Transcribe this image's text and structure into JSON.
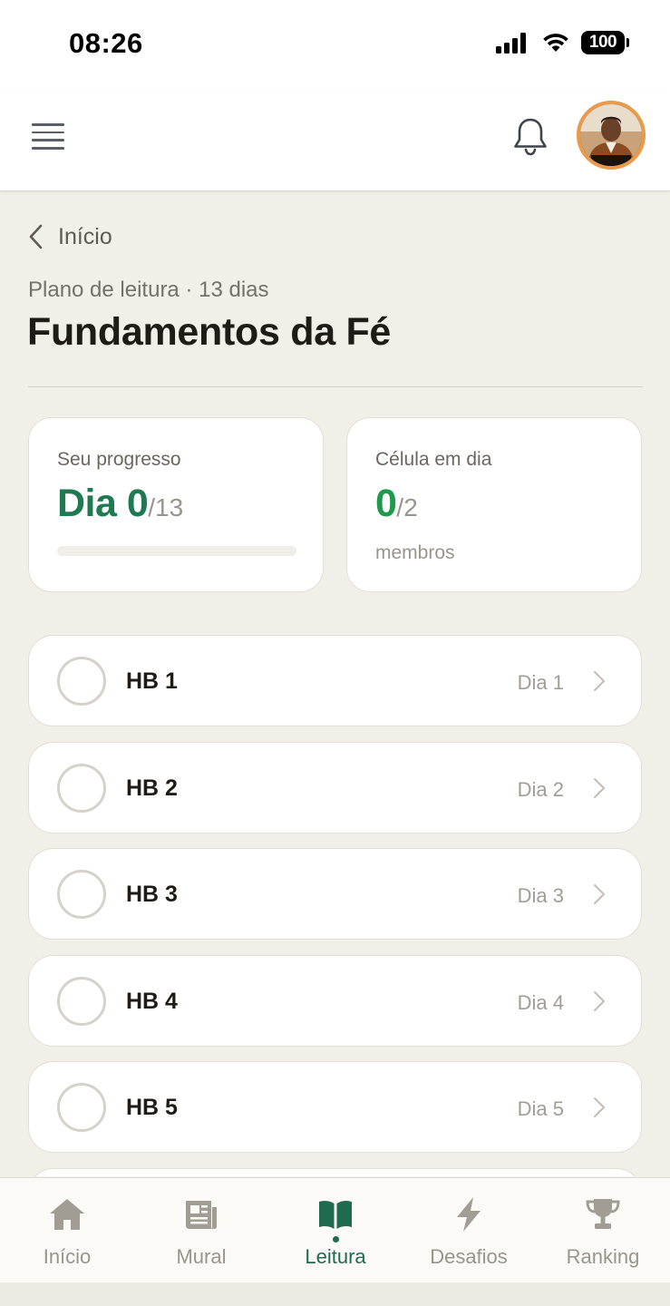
{
  "status_bar": {
    "time": "08:26",
    "battery": "100"
  },
  "header": {
    "menu_icon": "hamburger-menu-icon",
    "notification_icon": "bell-icon",
    "avatar": "user-avatar"
  },
  "breadcrumb": {
    "back_label": "Início",
    "back_icon": "chevron-left-icon"
  },
  "plan": {
    "subtitle": "Plano de leitura · 13 dias",
    "title": "Fundamentos da Fé"
  },
  "stats": {
    "progress": {
      "label": "Seu progresso",
      "value": "Dia 0",
      "total": "/13",
      "progress_fraction": 0
    },
    "cell": {
      "label": "Célula em dia",
      "value": "0",
      "total": "/2",
      "unit": "membros"
    }
  },
  "readings": [
    {
      "title": "HB 1",
      "day": "Dia 1",
      "completed": false
    },
    {
      "title": "HB 2",
      "day": "Dia 2",
      "completed": false
    },
    {
      "title": "HB 3",
      "day": "Dia 3",
      "completed": false
    },
    {
      "title": "HB 4",
      "day": "Dia 4",
      "completed": false
    },
    {
      "title": "HB 5",
      "day": "Dia 5",
      "completed": false
    },
    {
      "title": "",
      "day": "",
      "completed": false
    }
  ],
  "bottom_nav": [
    {
      "label": "Início",
      "icon": "home-icon",
      "active": false
    },
    {
      "label": "Mural",
      "icon": "newspaper-icon",
      "active": false
    },
    {
      "label": "Leitura",
      "icon": "book-open-icon",
      "active": true
    },
    {
      "label": "Desafios",
      "icon": "lightning-icon",
      "active": false
    },
    {
      "label": "Ranking",
      "icon": "trophy-icon",
      "active": false
    }
  ],
  "colors": {
    "accent_green": "#1f7a52",
    "bright_green": "#1e9a4b",
    "background": "#f0efe8",
    "avatar_ring": "#e99a4b"
  }
}
